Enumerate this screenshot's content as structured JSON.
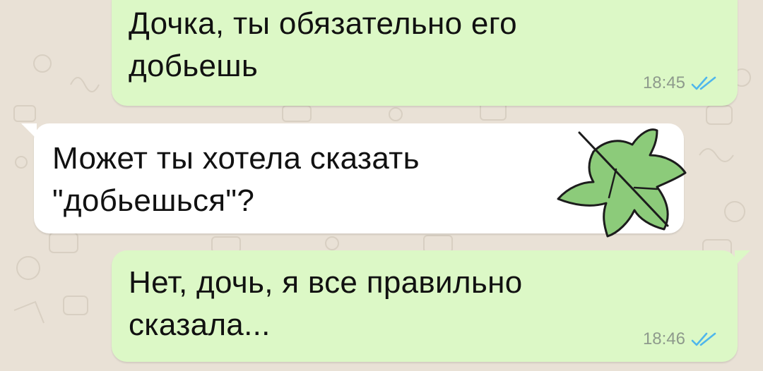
{
  "chat": {
    "messages": [
      {
        "direction": "outgoing",
        "text": "Дочка, ты обязательно его\nдобьешь",
        "time": "18:45",
        "status": "read"
      },
      {
        "direction": "incoming",
        "text": "Может ты хотела сказать\n\"добьешься\"?",
        "sticker": "leaf-icon"
      },
      {
        "direction": "outgoing",
        "text": "Нет, дочь, я все правильно\nсказала...",
        "time": "18:46",
        "status": "read"
      }
    ]
  },
  "colors": {
    "wallpaper": "#e9e1d6",
    "outgoing_bubble": "#dcf8c6",
    "incoming_bubble": "#ffffff",
    "read_ticks": "#4fb6ec",
    "timestamp": "#8e9a8c",
    "leaf_fill": "#8ccb7a"
  }
}
